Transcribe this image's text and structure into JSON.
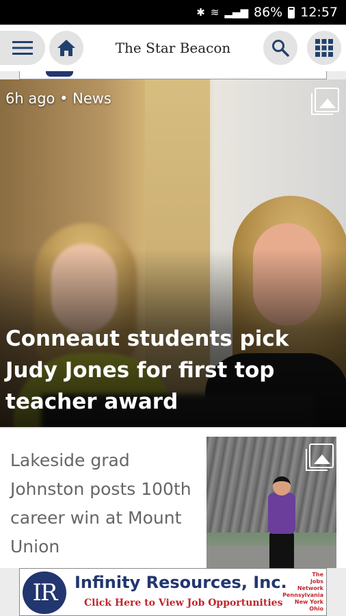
{
  "status_bar": {
    "battery_percent": "86%",
    "time": "12:57"
  },
  "app_bar": {
    "title": "The Star Beacon"
  },
  "hero": {
    "meta": "6h ago • News",
    "headline": "Conneaut students pick Judy Jones for first top teacher award"
  },
  "story": {
    "title": "Lakeside grad Johnston posts 100th career win at Mount Union"
  },
  "ad": {
    "logo_text": "IR",
    "company": "Infinity Resources, Inc.",
    "cta": "Click Here to View Job Opportunities",
    "side_lines": [
      "The",
      "Jobs",
      "Network",
      "Pennsylvania",
      "New York",
      "Ohio"
    ]
  },
  "colors": {
    "ad_blue": "#22366f",
    "ad_red": "#c0262d",
    "button_bg": "#e3e3e3"
  }
}
